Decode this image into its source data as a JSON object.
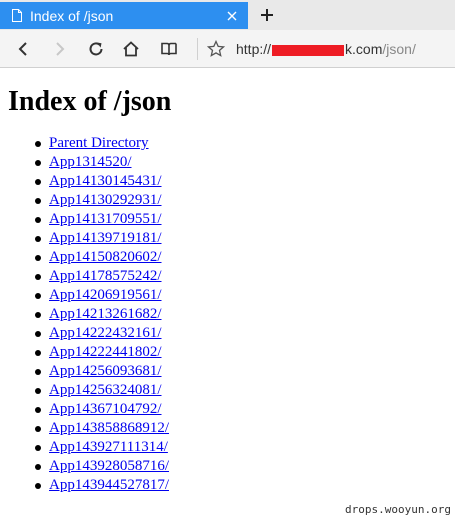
{
  "browser": {
    "tab_title": "Index of /json",
    "url_prefix": "http://",
    "url_domain_suffix": "k.com",
    "url_path": "/json/"
  },
  "page": {
    "heading": "Index of /json",
    "links": [
      "Parent Directory",
      "App1314520/",
      "App14130145431/",
      "App14130292931/",
      "App14131709551/",
      "App14139719181/",
      "App14150820602/",
      "App14178575242/",
      "App14206919561/",
      "App14213261682/",
      "App14222432161/",
      "App14222441802/",
      "App14256093681/",
      "App14256324081/",
      "App14367104792/",
      "App143858868912/",
      "App143927111314/",
      "App143928058716/",
      "App143944527817/"
    ]
  },
  "watermark": "drops.wooyun.org",
  "colors": {
    "tab_active": "#2d8ff0",
    "link": "#0000ee",
    "redaction": "#ee1c24"
  }
}
